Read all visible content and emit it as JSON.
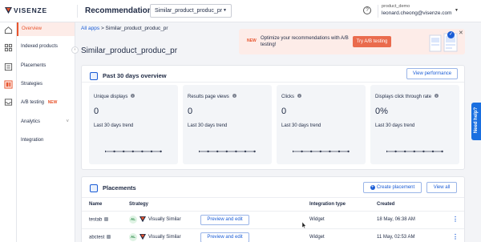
{
  "brand": {
    "name": "VISENZE",
    "accent": "#e8552e",
    "link": "#1a5cd6"
  },
  "topbar": {
    "title": "Recommendations",
    "app_select": "Similar_product_produc_pr",
    "help_icon": "question-circle-icon",
    "account_name": "product_demo",
    "account_email": "leonard.cheong@visenze.com"
  },
  "rail": {
    "icons": [
      "home-icon",
      "grid-icon",
      "list-icon",
      "recommend-icon",
      "inbox-icon"
    ]
  },
  "sidebar": {
    "items": [
      {
        "label": "Overview",
        "active": true
      },
      {
        "label": "Indexed products"
      },
      {
        "label": "Placements"
      },
      {
        "label": "Strategies"
      },
      {
        "label": "A/B testing",
        "badge": "NEW"
      },
      {
        "label": "Analytics",
        "chevron": "˅"
      },
      {
        "label": "Integration"
      }
    ],
    "collapse_icon": "‹"
  },
  "breadcrumb": {
    "root": "All apps",
    "separator": ">",
    "current": "Similar_product_produc_pr"
  },
  "page_title": "Similar_product_produc_pr",
  "promo": {
    "badge": "NEW",
    "text": "Optimize your recommendations with A/B testing!",
    "button": "Try A/B testing",
    "close": "✕"
  },
  "overview": {
    "title": "Past 30 days overview",
    "view_button": "View performance",
    "metrics": [
      {
        "label": "Unique displays",
        "value": "0",
        "trend": "Last 30 days trend"
      },
      {
        "label": "Results page views",
        "value": "0",
        "trend": "Last 30 days trend"
      },
      {
        "label": "Clicks",
        "value": "0",
        "trend": "Last 30 days trend"
      },
      {
        "label": "Displays click through rate",
        "value": "0%",
        "trend": "Last 30 days trend"
      }
    ]
  },
  "placements": {
    "title": "Placements",
    "create_button": "Create placement",
    "view_all": "View all",
    "columns": [
      "Name",
      "Strategy",
      "Integration type",
      "Created"
    ],
    "rows": [
      {
        "name": "testab",
        "strategy_badge": "AL",
        "strategy": "Visually Similar",
        "action": "Preview and edit",
        "integration": "Widget",
        "created": "18 May, 06:38 AM"
      },
      {
        "name": "abctest",
        "strategy_badge": "AL",
        "strategy": "Visually Similar",
        "action": "Preview and edit",
        "integration": "Widget",
        "created": "11 May, 02:53 AM"
      }
    ]
  },
  "help_tab": "Need help?"
}
